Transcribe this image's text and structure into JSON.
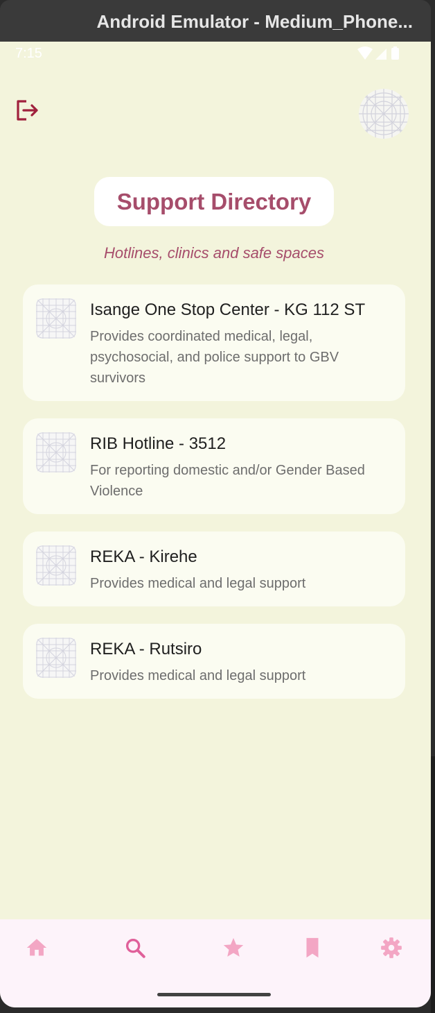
{
  "window": {
    "title": "Android Emulator - Medium_Phone..."
  },
  "status_bar": {
    "time": "7:15",
    "icons": [
      "wifi-icon",
      "signal-icon",
      "battery-icon"
    ]
  },
  "header": {
    "logout_icon": "logout-icon",
    "avatar_icon": "placeholder-image-icon",
    "title": "Support Directory",
    "subtitle": "Hotlines, clinics and safe spaces"
  },
  "directory": [
    {
      "name": "Isange One Stop Center - KG 112 ST",
      "description": "Provides coordinated medical, legal, psychosocial, and police support to GBV survivors"
    },
    {
      "name": "RIB Hotline - 3512",
      "description": "For reporting domestic and/or Gender Based Violence"
    },
    {
      "name": "REKA - Kirehe",
      "description": "Provides medical and legal support"
    },
    {
      "name": "REKA - Rutsiro",
      "description": "Provides medical and legal support"
    }
  ],
  "bottom_nav": {
    "items": [
      "home-icon",
      "search-icon",
      "star-icon",
      "bookmark-icon",
      "settings-icon"
    ],
    "active": "search-icon"
  },
  "colors": {
    "background": "#f3f4dc",
    "accent": "#a64d6b",
    "logout": "#a0213d",
    "card": "#fbfcf1",
    "nav_background": "#fdf3fa",
    "nav_icon": "#f3a6c4",
    "nav_icon_active": "#e0609a"
  }
}
